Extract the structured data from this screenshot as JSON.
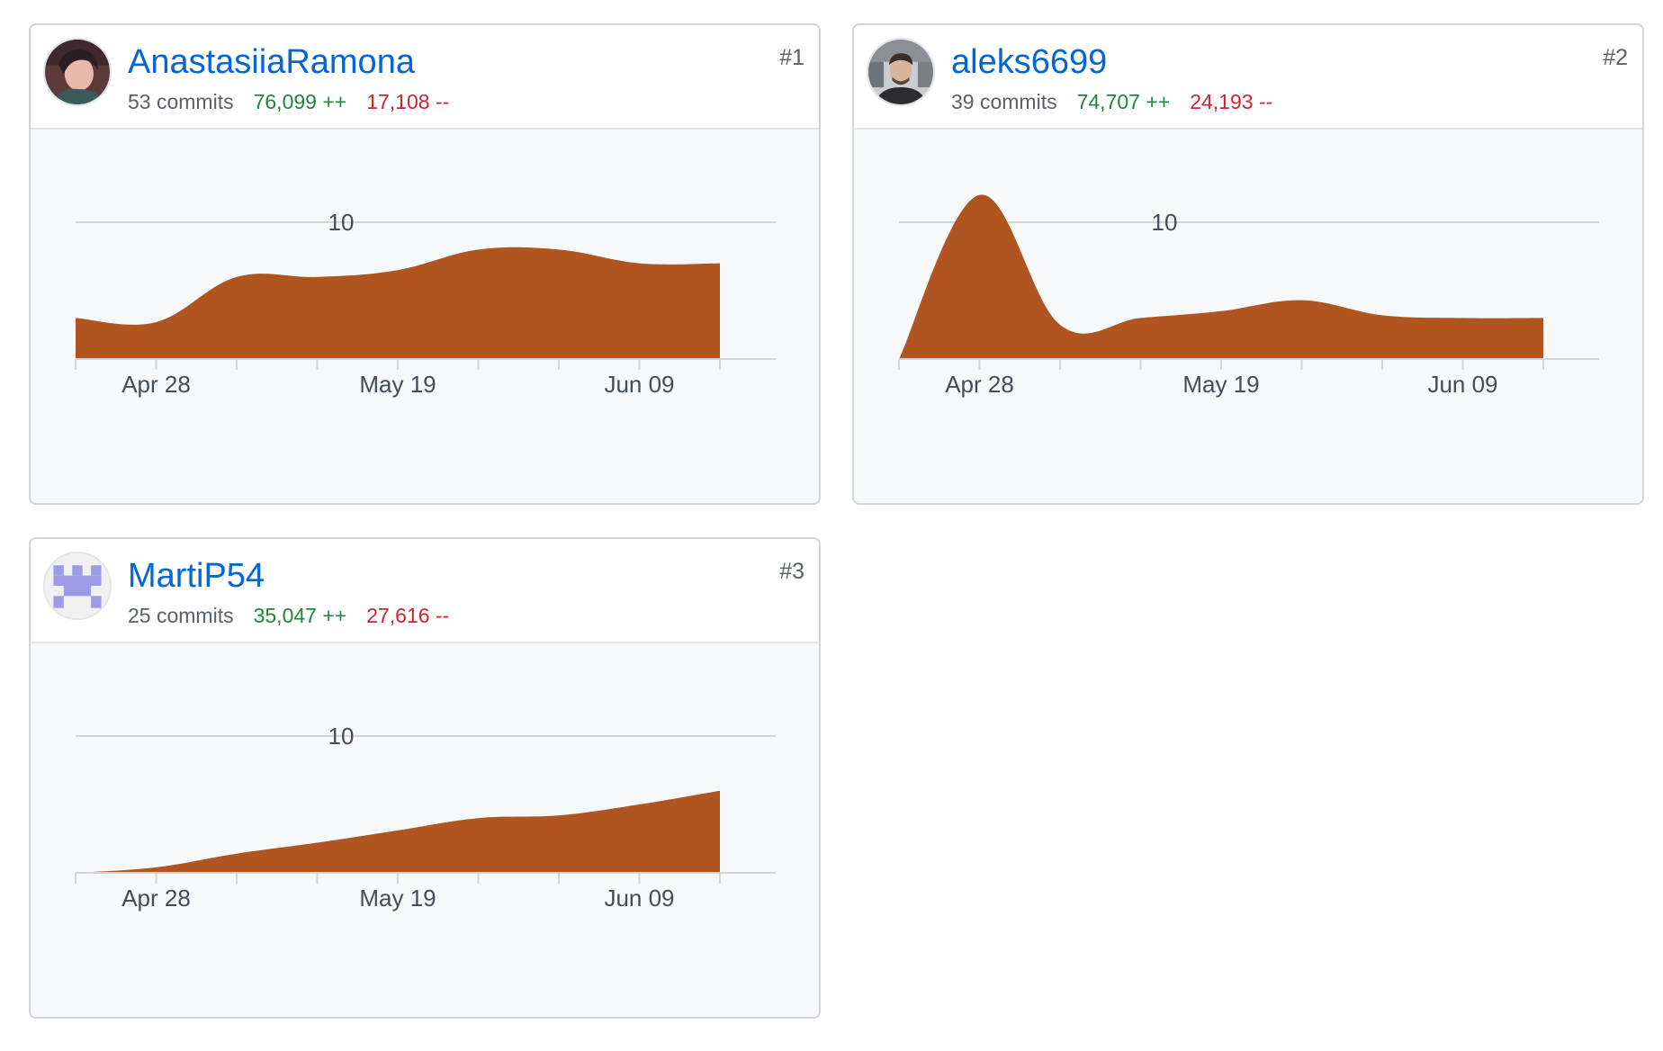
{
  "contributors": [
    {
      "rank": "#1",
      "username": "AnastasiiaRamona",
      "commits": "53 commits",
      "additions": "76,099 ++",
      "deletions": "17,108 --",
      "avatar_icon": "user-photo-avatar"
    },
    {
      "rank": "#2",
      "username": "aleks6699",
      "commits": "39 commits",
      "additions": "74,707 ++",
      "deletions": "24,193 --",
      "avatar_icon": "user-photo-avatar"
    },
    {
      "rank": "#3",
      "username": "MartiP54",
      "commits": "25 commits",
      "additions": "35,047 ++",
      "deletions": "27,616 --",
      "avatar_icon": "identicon-avatar"
    }
  ],
  "colors": {
    "area_fill": "#b05420",
    "link": "#0366d6",
    "additions": "#22863a",
    "deletions": "#cb2431",
    "identicon": "#9b9be6"
  },
  "chart_data": [
    {
      "type": "area",
      "x": [
        "Apr 21",
        "Apr 28",
        "May 05",
        "May 12",
        "May 19",
        "May 26",
        "Jun 02",
        "Jun 09",
        "Jun 16"
      ],
      "values": [
        3,
        2.7,
        6,
        6,
        6.5,
        8,
        8,
        7,
        7
      ],
      "x_tick_labels": [
        "Apr 28",
        "May 19",
        "Jun 09"
      ],
      "y_tick_labels": [
        "10"
      ],
      "ylim": [
        0,
        13
      ]
    },
    {
      "type": "area",
      "x": [
        "Apr 21",
        "Apr 28",
        "May 05",
        "May 12",
        "May 19",
        "May 26",
        "Jun 02",
        "Jun 09",
        "Jun 16"
      ],
      "values": [
        0,
        12,
        2.5,
        3,
        3.5,
        4.3,
        3.2,
        3,
        3
      ],
      "x_tick_labels": [
        "Apr 28",
        "May 19",
        "Jun 09"
      ],
      "y_tick_labels": [
        "10"
      ],
      "ylim": [
        0,
        13
      ]
    },
    {
      "type": "area",
      "x": [
        "Apr 21",
        "Apr 28",
        "May 05",
        "May 12",
        "May 19",
        "May 26",
        "Jun 02",
        "Jun 09",
        "Jun 16"
      ],
      "values": [
        0,
        0.4,
        1.4,
        2.2,
        3.1,
        4,
        4.2,
        5,
        6
      ],
      "x_tick_labels": [
        "Apr 28",
        "May 19",
        "Jun 09"
      ],
      "y_tick_labels": [
        "10"
      ],
      "ylim": [
        0,
        13
      ]
    }
  ]
}
